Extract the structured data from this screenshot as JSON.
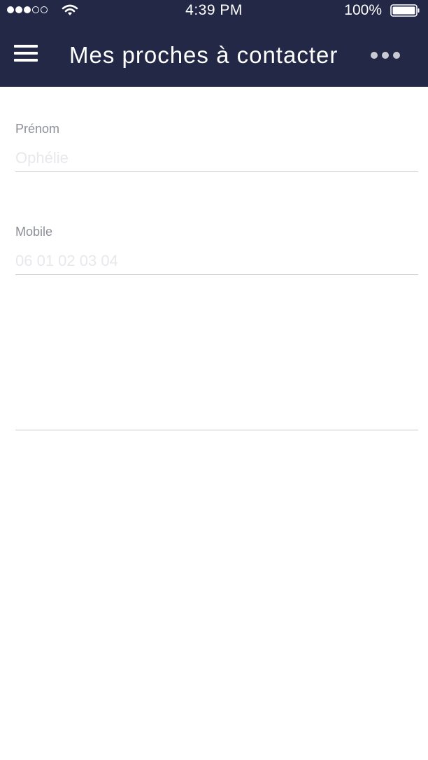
{
  "status_bar": {
    "signal_bars": 5,
    "signal_filled": 3,
    "time": "4:39 PM",
    "battery": "100%"
  },
  "header": {
    "title": "Mes proches à contacter",
    "menu_icon": "hamburger-menu-icon",
    "more_icon": "more-dots-icon",
    "background": "#222846"
  },
  "form": {
    "first_name": {
      "label": "Prénom",
      "placeholder": "Ophélie",
      "value": ""
    },
    "mobile": {
      "label": "Mobile",
      "placeholder": "06 01 02 03 04",
      "value": ""
    }
  }
}
